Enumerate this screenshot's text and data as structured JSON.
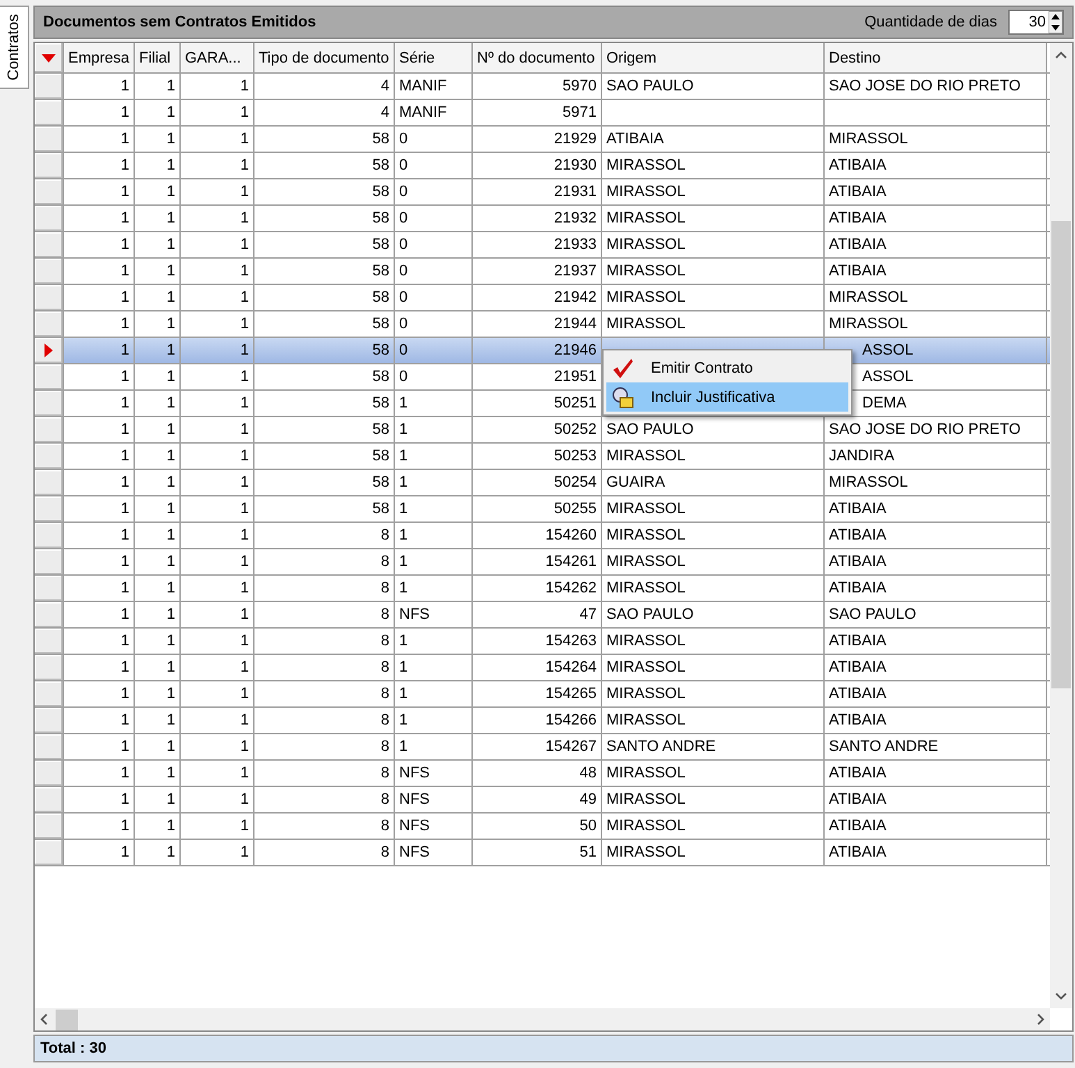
{
  "side_tab": {
    "label": "Contratos",
    "selected": true
  },
  "panel": {
    "title": "Documentos sem Contratos Emitidos",
    "days_label": "Quantidade de dias",
    "days_value": "30"
  },
  "table": {
    "columns": [
      {
        "label": "Empresa",
        "kind": "number"
      },
      {
        "label": "Filial",
        "kind": "number"
      },
      {
        "label": "GARA...",
        "kind": "number"
      },
      {
        "label": "Tipo de documento",
        "kind": "number"
      },
      {
        "label": "Série",
        "kind": "text"
      },
      {
        "label": "Nº do documento",
        "kind": "number"
      },
      {
        "label": "Origem",
        "kind": "text"
      },
      {
        "label": "Destino",
        "kind": "text"
      }
    ],
    "rows": [
      {
        "selected": false,
        "cells": [
          "1",
          "1",
          "1",
          "4",
          "MANIF",
          "5970",
          "SAO PAULO",
          "SAO JOSE DO RIO PRETO"
        ]
      },
      {
        "selected": false,
        "cells": [
          "1",
          "1",
          "1",
          "4",
          "MANIF",
          "5971",
          null,
          null
        ]
      },
      {
        "selected": false,
        "cells": [
          "1",
          "1",
          "1",
          "58",
          "0",
          "21929",
          "ATIBAIA",
          "MIRASSOL"
        ]
      },
      {
        "selected": false,
        "cells": [
          "1",
          "1",
          "1",
          "58",
          "0",
          "21930",
          "MIRASSOL",
          "ATIBAIA"
        ]
      },
      {
        "selected": false,
        "cells": [
          "1",
          "1",
          "1",
          "58",
          "0",
          "21931",
          "MIRASSOL",
          "ATIBAIA"
        ]
      },
      {
        "selected": false,
        "cells": [
          "1",
          "1",
          "1",
          "58",
          "0",
          "21932",
          "MIRASSOL",
          "ATIBAIA"
        ]
      },
      {
        "selected": false,
        "cells": [
          "1",
          "1",
          "1",
          "58",
          "0",
          "21933",
          "MIRASSOL",
          "ATIBAIA"
        ]
      },
      {
        "selected": false,
        "cells": [
          "1",
          "1",
          "1",
          "58",
          "0",
          "21937",
          "MIRASSOL",
          "ATIBAIA"
        ]
      },
      {
        "selected": false,
        "cells": [
          "1",
          "1",
          "1",
          "58",
          "0",
          "21942",
          "MIRASSOL",
          "MIRASSOL"
        ]
      },
      {
        "selected": false,
        "cells": [
          "1",
          "1",
          "1",
          "58",
          "0",
          "21944",
          "MIRASSOL",
          "MIRASSOL"
        ]
      },
      {
        "selected": true,
        "partly_covered": true,
        "cells": [
          "1",
          "1",
          "1",
          "58",
          "0",
          "21946",
          null,
          "ASSOL"
        ]
      },
      {
        "selected": false,
        "partly_covered": true,
        "cells": [
          "1",
          "1",
          "1",
          "58",
          "0",
          "21951",
          null,
          "ASSOL"
        ]
      },
      {
        "selected": false,
        "partly_covered": true,
        "cells": [
          "1",
          "1",
          "1",
          "58",
          "1",
          "50251",
          null,
          "DEMA"
        ]
      },
      {
        "selected": false,
        "cells": [
          "1",
          "1",
          "1",
          "58",
          "1",
          "50252",
          "SAO PAULO",
          "SAO JOSE DO RIO PRETO"
        ]
      },
      {
        "selected": false,
        "cells": [
          "1",
          "1",
          "1",
          "58",
          "1",
          "50253",
          "MIRASSOL",
          "JANDIRA"
        ]
      },
      {
        "selected": false,
        "cells": [
          "1",
          "1",
          "1",
          "58",
          "1",
          "50254",
          "GUAIRA",
          "MIRASSOL"
        ]
      },
      {
        "selected": false,
        "cells": [
          "1",
          "1",
          "1",
          "58",
          "1",
          "50255",
          "MIRASSOL",
          "ATIBAIA"
        ]
      },
      {
        "selected": false,
        "cells": [
          "1",
          "1",
          "1",
          "8",
          "1",
          "154260",
          "MIRASSOL",
          "ATIBAIA"
        ]
      },
      {
        "selected": false,
        "cells": [
          "1",
          "1",
          "1",
          "8",
          "1",
          "154261",
          "MIRASSOL",
          "ATIBAIA"
        ]
      },
      {
        "selected": false,
        "cells": [
          "1",
          "1",
          "1",
          "8",
          "1",
          "154262",
          "MIRASSOL",
          "ATIBAIA"
        ]
      },
      {
        "selected": false,
        "cells": [
          "1",
          "1",
          "1",
          "8",
          "NFS",
          "47",
          "SAO PAULO",
          "SAO PAULO"
        ]
      },
      {
        "selected": false,
        "cells": [
          "1",
          "1",
          "1",
          "8",
          "1",
          "154263",
          "MIRASSOL",
          "ATIBAIA"
        ]
      },
      {
        "selected": false,
        "cells": [
          "1",
          "1",
          "1",
          "8",
          "1",
          "154264",
          "MIRASSOL",
          "ATIBAIA"
        ]
      },
      {
        "selected": false,
        "cells": [
          "1",
          "1",
          "1",
          "8",
          "1",
          "154265",
          "MIRASSOL",
          "ATIBAIA"
        ]
      },
      {
        "selected": false,
        "cells": [
          "1",
          "1",
          "1",
          "8",
          "1",
          "154266",
          "MIRASSOL",
          "ATIBAIA"
        ]
      },
      {
        "selected": false,
        "cells": [
          "1",
          "1",
          "1",
          "8",
          "1",
          "154267",
          "SANTO ANDRE",
          "SANTO ANDRE"
        ]
      },
      {
        "selected": false,
        "cells": [
          "1",
          "1",
          "1",
          "8",
          "NFS",
          "48",
          "MIRASSOL",
          "ATIBAIA"
        ]
      },
      {
        "selected": false,
        "cells": [
          "1",
          "1",
          "1",
          "8",
          "NFS",
          "49",
          "MIRASSOL",
          "ATIBAIA"
        ]
      },
      {
        "selected": false,
        "cells": [
          "1",
          "1",
          "1",
          "8",
          "NFS",
          "50",
          "MIRASSOL",
          "ATIBAIA"
        ]
      },
      {
        "selected": false,
        "cells": [
          "1",
          "1",
          "1",
          "8",
          "NFS",
          "51",
          "MIRASSOL",
          "ATIBAIA"
        ]
      }
    ]
  },
  "context_menu": {
    "items": [
      {
        "label": "Emitir Contrato",
        "kind": "check",
        "selected": false
      },
      {
        "label": "Incluir Justificativa",
        "kind": "add-note",
        "selected": true
      }
    ]
  },
  "status_bar": {
    "total": "Total : 30"
  }
}
